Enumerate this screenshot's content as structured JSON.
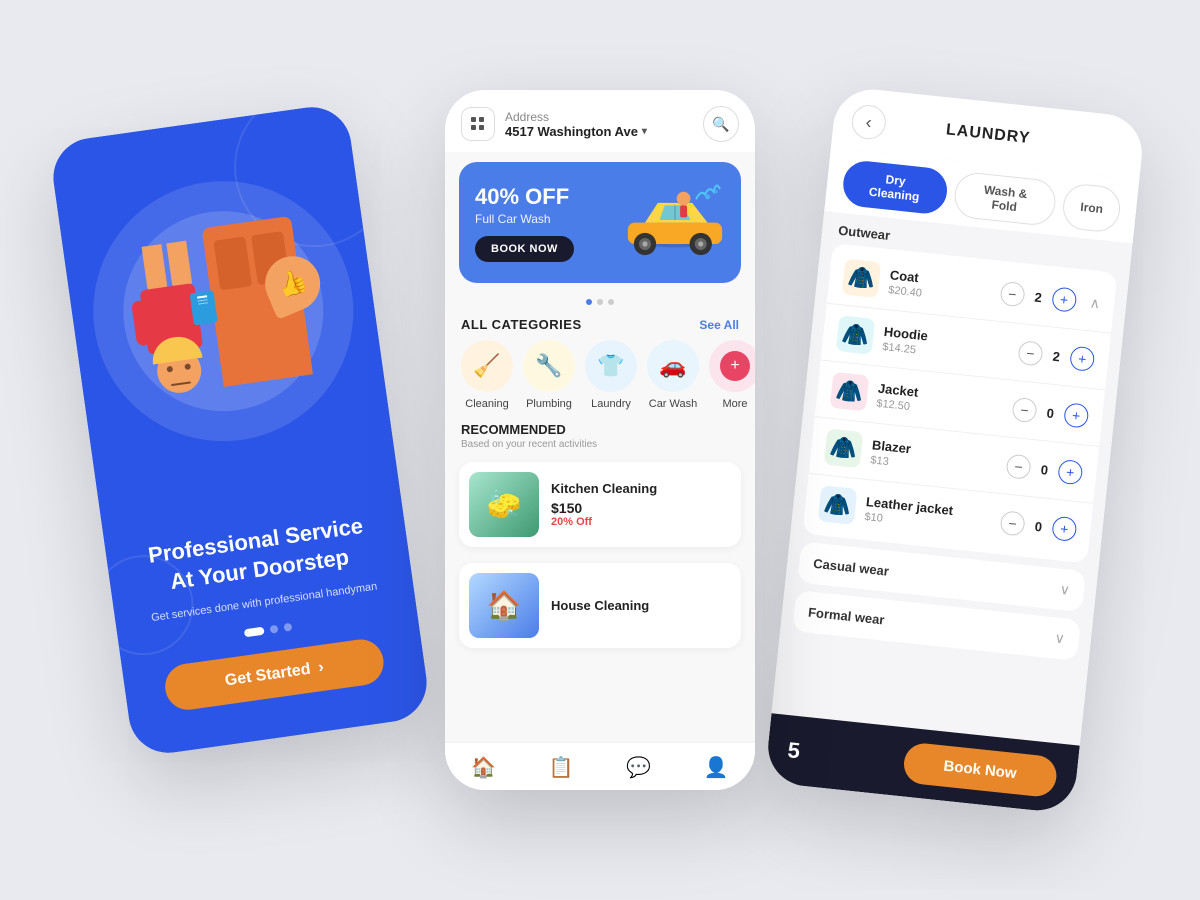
{
  "phone1": {
    "title": "Professional Service\nAt Your Doorstep",
    "subtitle": "Get services done with professional handyman",
    "cta_label": "Get Started",
    "dots": [
      "active",
      "inactive",
      "inactive"
    ]
  },
  "phone2": {
    "header": {
      "icon": "grid-icon",
      "address_label": "Address",
      "address_value": "4517 Washington Ave",
      "search_icon": "search-icon"
    },
    "banner": {
      "discount": "40% OFF",
      "service": "Full Car Wash",
      "cta": "BOOK NOW"
    },
    "categories_title": "ALL CATEGORIES",
    "see_all": "See All",
    "categories": [
      {
        "label": "Cleaning",
        "emoji": "🧹"
      },
      {
        "label": "Plumbing",
        "emoji": "🔧"
      },
      {
        "label": "Laundry",
        "emoji": "👕"
      },
      {
        "label": "Car Wash",
        "emoji": "🚗"
      },
      {
        "label": "More",
        "emoji": "➕"
      }
    ],
    "recommended_title": "RECOMMENDED",
    "recommended_sub": "Based on your recent activities",
    "services": [
      {
        "name": "Kitchen Cleaning",
        "price": "$150",
        "discount": "20% Off",
        "emoji": "🧽",
        "has_discount": true
      },
      {
        "name": "House Cleaning",
        "price": "",
        "discount": "",
        "emoji": "🏠",
        "has_discount": false
      }
    ],
    "nav": [
      {
        "icon": "🏠",
        "label": "home",
        "active": true
      },
      {
        "icon": "📋",
        "label": "orders",
        "active": false
      },
      {
        "icon": "💬",
        "label": "messages",
        "active": false
      },
      {
        "icon": "👤",
        "label": "profile",
        "active": false
      }
    ]
  },
  "phone3": {
    "title": "LAUNDRY",
    "back_label": "back",
    "tabs": [
      {
        "label": "Dry Cleaning",
        "active": true
      },
      {
        "label": "Wash & Fold",
        "active": false
      },
      {
        "label": "Iron",
        "active": false
      }
    ],
    "sections": [
      {
        "label": "Outwear",
        "expanded": true,
        "items": [
          {
            "name": "Coat",
            "price": "$20.40",
            "emoji": "🧥",
            "count": 2,
            "color": "#f4a261"
          },
          {
            "name": "Hoodie",
            "price": "$14.25",
            "emoji": "🧥",
            "count": 2,
            "color": "#4ab8c4"
          },
          {
            "name": "Jacket",
            "price": "$12.50",
            "emoji": "🧥",
            "count": 0,
            "color": "#e84545"
          },
          {
            "name": "Blazer",
            "price": "$13",
            "emoji": "🧥",
            "count": 0,
            "color": "#2db96a"
          },
          {
            "name": "Leather jacket",
            "price": "$10",
            "emoji": "🧥",
            "count": 0,
            "color": "#4a7de8"
          }
        ]
      },
      {
        "label": "Casual wear",
        "expanded": false
      },
      {
        "label": "Formal wear",
        "expanded": false
      }
    ],
    "footer": {
      "cart_count": "5",
      "book_label": "Book Now"
    }
  }
}
